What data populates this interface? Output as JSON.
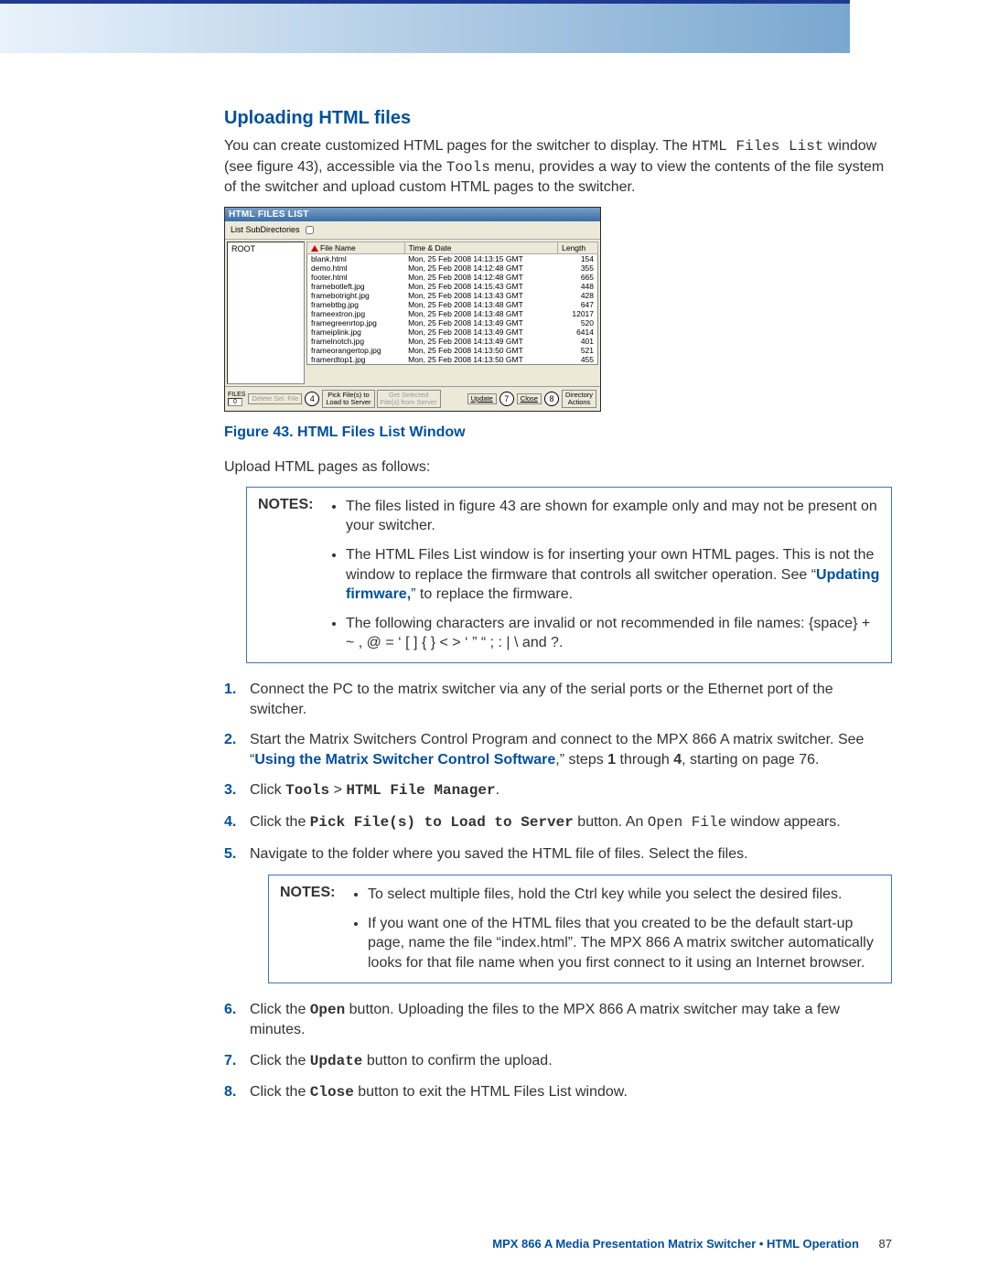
{
  "heading": "Uploading HTML files",
  "intro_parts": {
    "p1": "You can create customized HTML pages for the switcher to display. The ",
    "code1": "HTML Files List",
    "p2": " window (see figure 43), accessible via the ",
    "code2": "Tools",
    "p3": " menu, provides a way to view the contents of the file system of the switcher and upload custom HTML pages to the switcher."
  },
  "screenshot": {
    "title": "HTML FILES LIST",
    "subdir_label": "List SubDirectories",
    "root": "ROOT",
    "cols": {
      "file": "File Name",
      "date": "Time & Date",
      "len": "Length"
    },
    "rows": [
      {
        "f": "blank.html",
        "d": "Mon, 25 Feb 2008 14:13:15 GMT",
        "l": "154"
      },
      {
        "f": "demo.html",
        "d": "Mon, 25 Feb 2008 14:12:48 GMT",
        "l": "355"
      },
      {
        "f": "footer.html",
        "d": "Mon, 25 Feb 2008 14:12:48 GMT",
        "l": "665"
      },
      {
        "f": "framebotleft.jpg",
        "d": "Mon, 25 Feb 2008 14:15:43 GMT",
        "l": "448"
      },
      {
        "f": "framebotright.jpg",
        "d": "Mon, 25 Feb 2008 14:13:43 GMT",
        "l": "428"
      },
      {
        "f": "framebtbg.jpg",
        "d": "Mon, 25 Feb 2008 14:13:48 GMT",
        "l": "647"
      },
      {
        "f": "frameextron.jpg",
        "d": "Mon, 25 Feb 2008 14:13:48 GMT",
        "l": "12017"
      },
      {
        "f": "framegreenrtop.jpg",
        "d": "Mon, 25 Feb 2008 14:13:49 GMT",
        "l": "520"
      },
      {
        "f": "frameiplink.jpg",
        "d": "Mon, 25 Feb 2008 14:13:49 GMT",
        "l": "6414"
      },
      {
        "f": "framelnotch.jpg",
        "d": "Mon, 25 Feb 2008 14:13:49 GMT",
        "l": "401"
      },
      {
        "f": "frameorangertop.jpg",
        "d": "Mon, 25 Feb 2008 14:13:50 GMT",
        "l": "521"
      },
      {
        "f": "framerdtop1.jpg",
        "d": "Mon, 25 Feb 2008 14:13:50 GMT",
        "l": "455"
      }
    ],
    "bottom": {
      "files_label": "FILES",
      "files_count": "0",
      "delete_btn": "Delete Sel. File",
      "callout4": "4",
      "pick_btn_l1": "Pick File(s) to",
      "pick_btn_l2": "Load to Server",
      "getsel_l1": "Get Selected",
      "getsel_l2": "File(s) from Server",
      "update_btn": "Update",
      "callout7": "7",
      "close_btn": "Close",
      "callout8": "8",
      "diract_l1": "Directory",
      "diract_l2": "Actions"
    }
  },
  "fig_caption": "Figure 43. HTML Files List Window",
  "upload_intro": "Upload HTML pages as follows:",
  "notes_label": "NOTES:",
  "notes1": {
    "n1": "The files listed in figure 43 are shown for example only and may not be present on your switcher.",
    "n2a": "The HTML Files List window is for inserting your own HTML pages. This is not the window to replace the firmware that controls all switcher operation. See “",
    "n2link": "Updating firmware,",
    "n2b": "” to replace the firmware.",
    "n3": "The following characters are invalid or not recommended in file names: {space}  +  ~  ,  @  =  ‘  [  ]  {  }  <  >  ‘  ”  “  ;  :  |  \\  and ?."
  },
  "steps": {
    "s1": "Connect the PC to the matrix switcher via any of the serial ports or the Ethernet port of the switcher.",
    "s2a": "Start the Matrix Switchers Control Program and connect to the MPX 866 A matrix switcher. See “",
    "s2link": "Using the Matrix Switcher Control Software",
    "s2b": ",” steps ",
    "s2c": " through ",
    "s2d": ", starting on page 76.",
    "s2_b1": "1",
    "s2_b4": "4",
    "s3a": "Click ",
    "s3c1": "Tools",
    "s3mid": " > ",
    "s3c2": "HTML File Manager",
    "s3end": ".",
    "s4a": "Click the ",
    "s4c1": "Pick File(s) to Load to Server",
    "s4b": " button. An ",
    "s4c2": "Open File",
    "s4c": " window appears.",
    "s5": "Navigate to the folder where you saved the HTML file of files. Select the files.",
    "s6a": "Click the ",
    "s6c": "Open",
    "s6b": " button. Uploading the files to the MPX 866 A matrix switcher may take a few minutes.",
    "s7a": "Click the ",
    "s7c": "Update",
    "s7b": " button to confirm the upload.",
    "s8a": "Click the ",
    "s8c": "Close",
    "s8b": " button to exit the HTML Files List window."
  },
  "step_nums": {
    "1": "1.",
    "2": "2.",
    "3": "3.",
    "4": "4.",
    "5": "5.",
    "6": "6.",
    "7": "7.",
    "8": "8."
  },
  "notes2": {
    "n1": "To select multiple files, hold the Ctrl key while you select the desired files.",
    "n2": "If you want one of the HTML files that you created to be the default start-up page, name the file “index.html”. The MPX 866 A matrix switcher automatically looks for that file name when you first connect to it using an Internet browser."
  },
  "footer": {
    "title": "MPX 866 A Media Presentation Matrix Switcher • HTML Operation",
    "page": "87"
  }
}
